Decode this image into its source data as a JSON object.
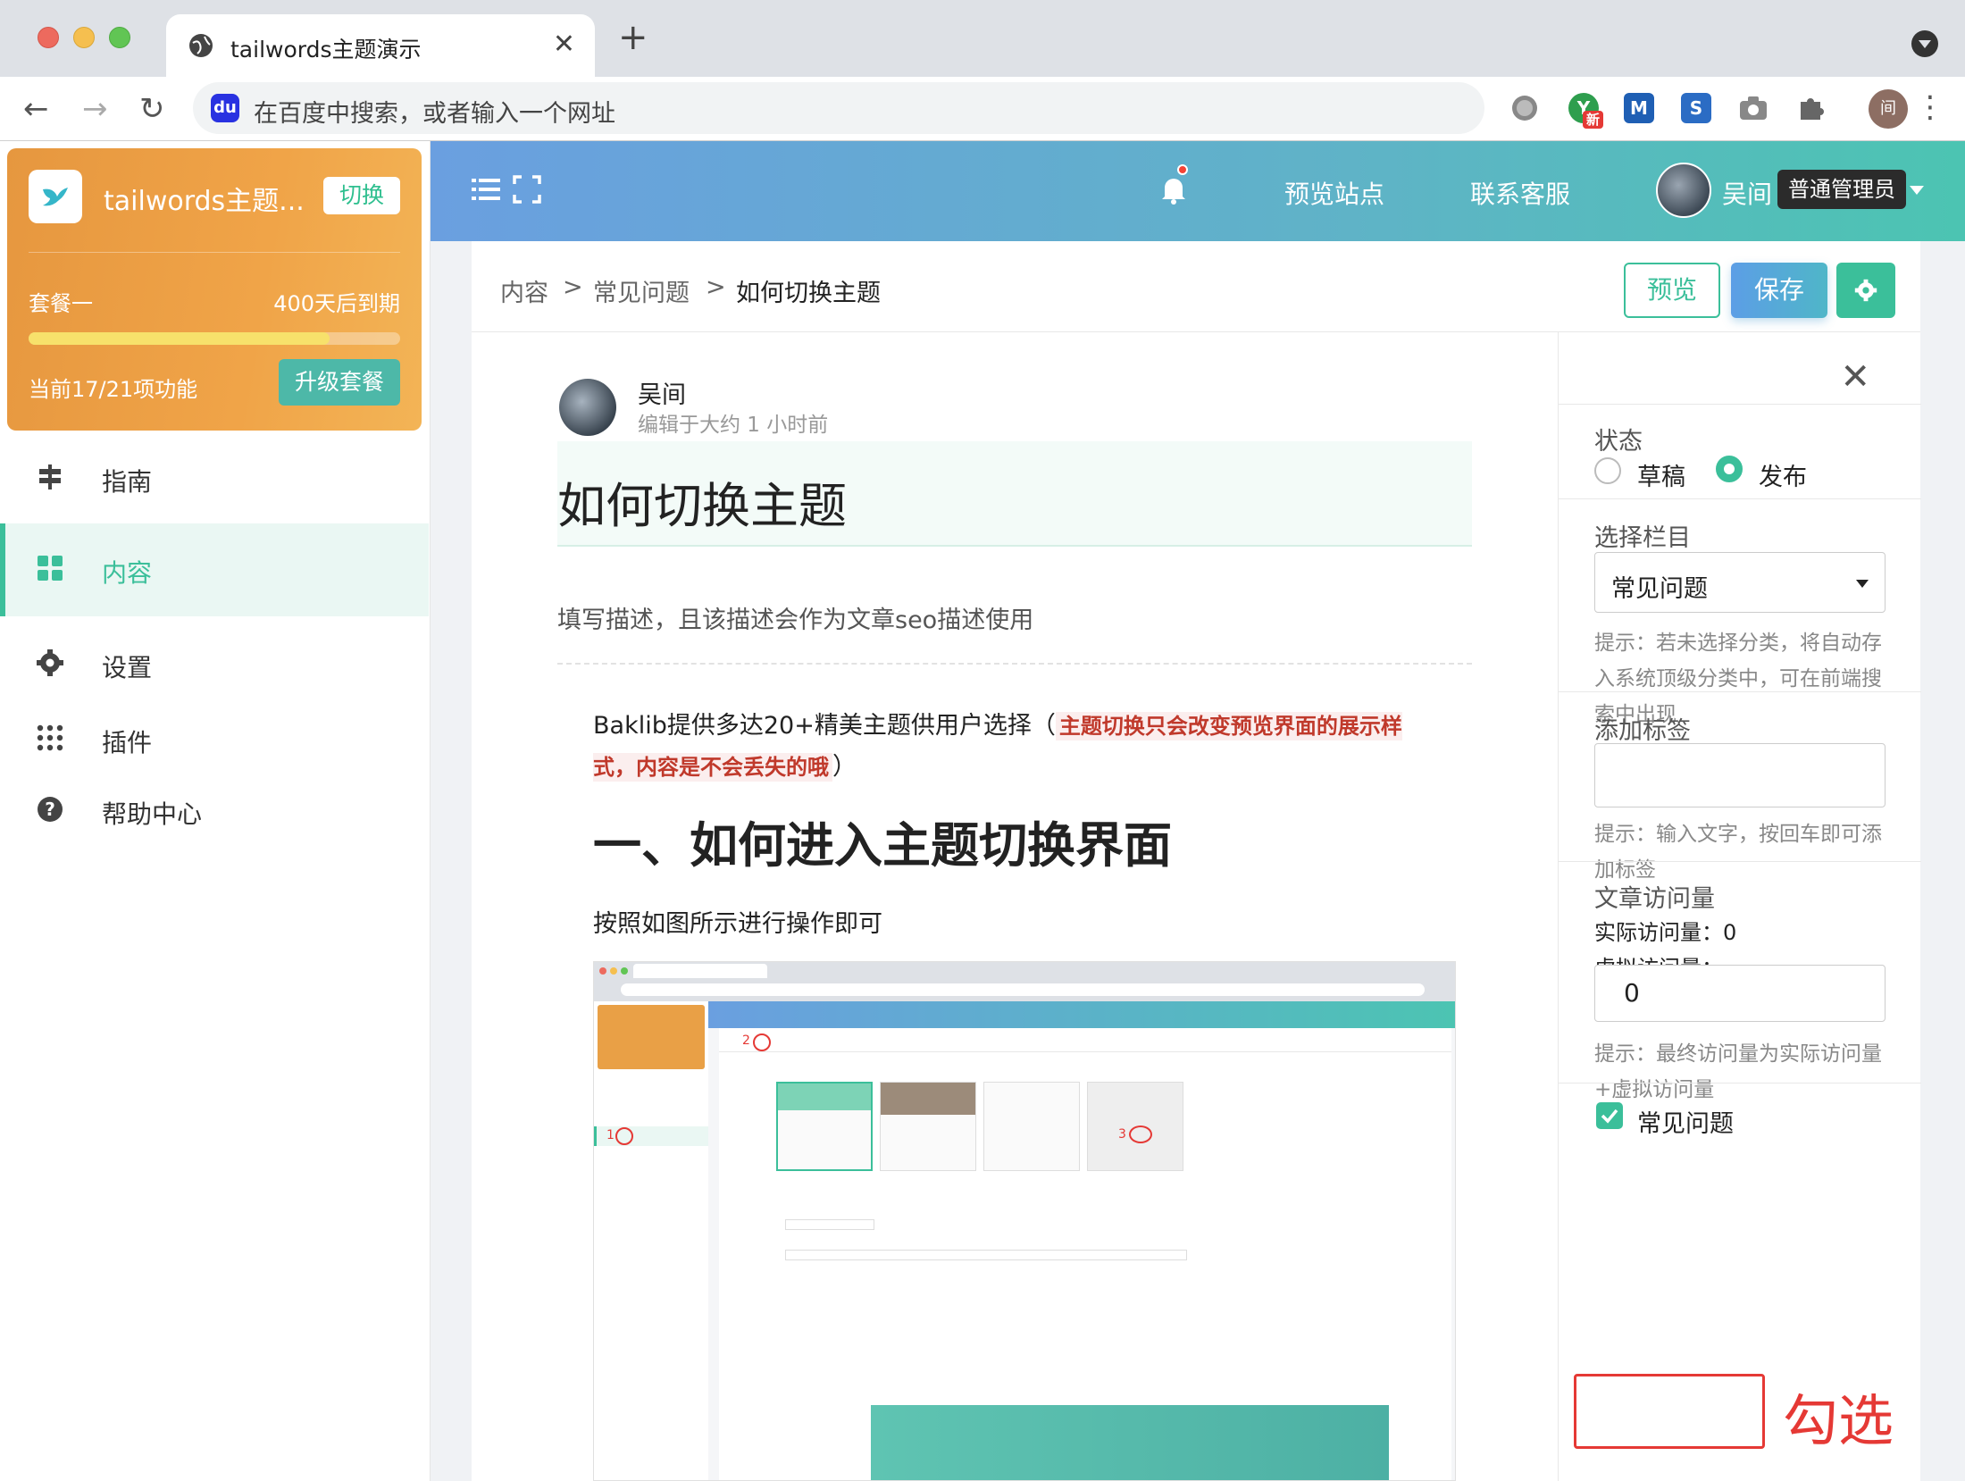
{
  "browser": {
    "tab_title": "tailwords主题演示",
    "tab_close": "✕",
    "new_tab": "+",
    "address_placeholder": "在百度中搜索，或者输入一个网址",
    "address_engine_icon": "baidu-icon",
    "ext_new_badge": "新",
    "ext_m_letter": "M",
    "ext_s_letter": "S",
    "profile_initial": "间"
  },
  "workspace": {
    "name": "tailwords主题...",
    "switch_label": "切换",
    "plan_name": "套餐一",
    "expires": "400天后到期",
    "features_used": "当前17/21项功能",
    "usage_fraction": 0.81,
    "upgrade_label": "升级套餐"
  },
  "nav": {
    "items": [
      {
        "label": "指南",
        "icon": "signpost-icon"
      },
      {
        "label": "内容",
        "icon": "grid-icon"
      },
      {
        "label": "设置",
        "icon": "gear-icon"
      },
      {
        "label": "插件",
        "icon": "dots-grid-icon"
      },
      {
        "label": "帮助中心",
        "icon": "question-icon"
      }
    ],
    "active_index": 1
  },
  "topbar": {
    "preview_site": "预览站点",
    "contact_support": "联系客服",
    "user_name": "吴间",
    "user_role": "普通管理员"
  },
  "editor": {
    "breadcrumb": [
      "内容",
      "常见问题",
      "如何切换主题"
    ],
    "breadcrumb_sep": ">",
    "preview_label": "预览",
    "save_label": "保存",
    "author_name": "吴间",
    "author_meta": "编辑于大约 1 小时前",
    "title": "如何切换主题",
    "description_placeholder": "填写描述，且该描述会作为文章seo描述使用",
    "para1_text": "Baklib提供多达20+精美主题供用户选择（",
    "para1_highlight": "主题切换只会改变预览界面的展示样式，内容是不会丢失的哦",
    "para1_end": "）",
    "heading": "一、如何进入主题切换界面",
    "para2": "按照如图所示进行操作即可",
    "screenshot_numbers": [
      "1",
      "2",
      "3"
    ]
  },
  "panel": {
    "close": "✕",
    "status_label": "状态",
    "status_draft": "草稿",
    "status_publish": "发布",
    "status_selected": "发布",
    "category_label": "选择栏目",
    "category_value": "常见问题",
    "category_hint": "提示：若未选择分类，将自动存入系统顶级分类中，可在前端搜索中出现",
    "tags_label": "添加标签",
    "tags_hint": "提示：输入文字，按回车即可添加标签",
    "views_label": "文章访问量",
    "actual_views": "实际访问量：0",
    "virtual_views_label": "虚拟访问量：",
    "virtual_views_value": "0",
    "views_hint": "提示：最终访问量为实际访问量+虚拟访问量",
    "faq_checkbox_label": "常见问题",
    "faq_checked": true
  },
  "annotation": {
    "text": "勾选",
    "color": "#e53935"
  },
  "colors": {
    "accent": "#3bbf9a",
    "plan_card": "#f0a448",
    "topbar_start": "#6a9fe0",
    "topbar_end": "#4cc4b2"
  }
}
